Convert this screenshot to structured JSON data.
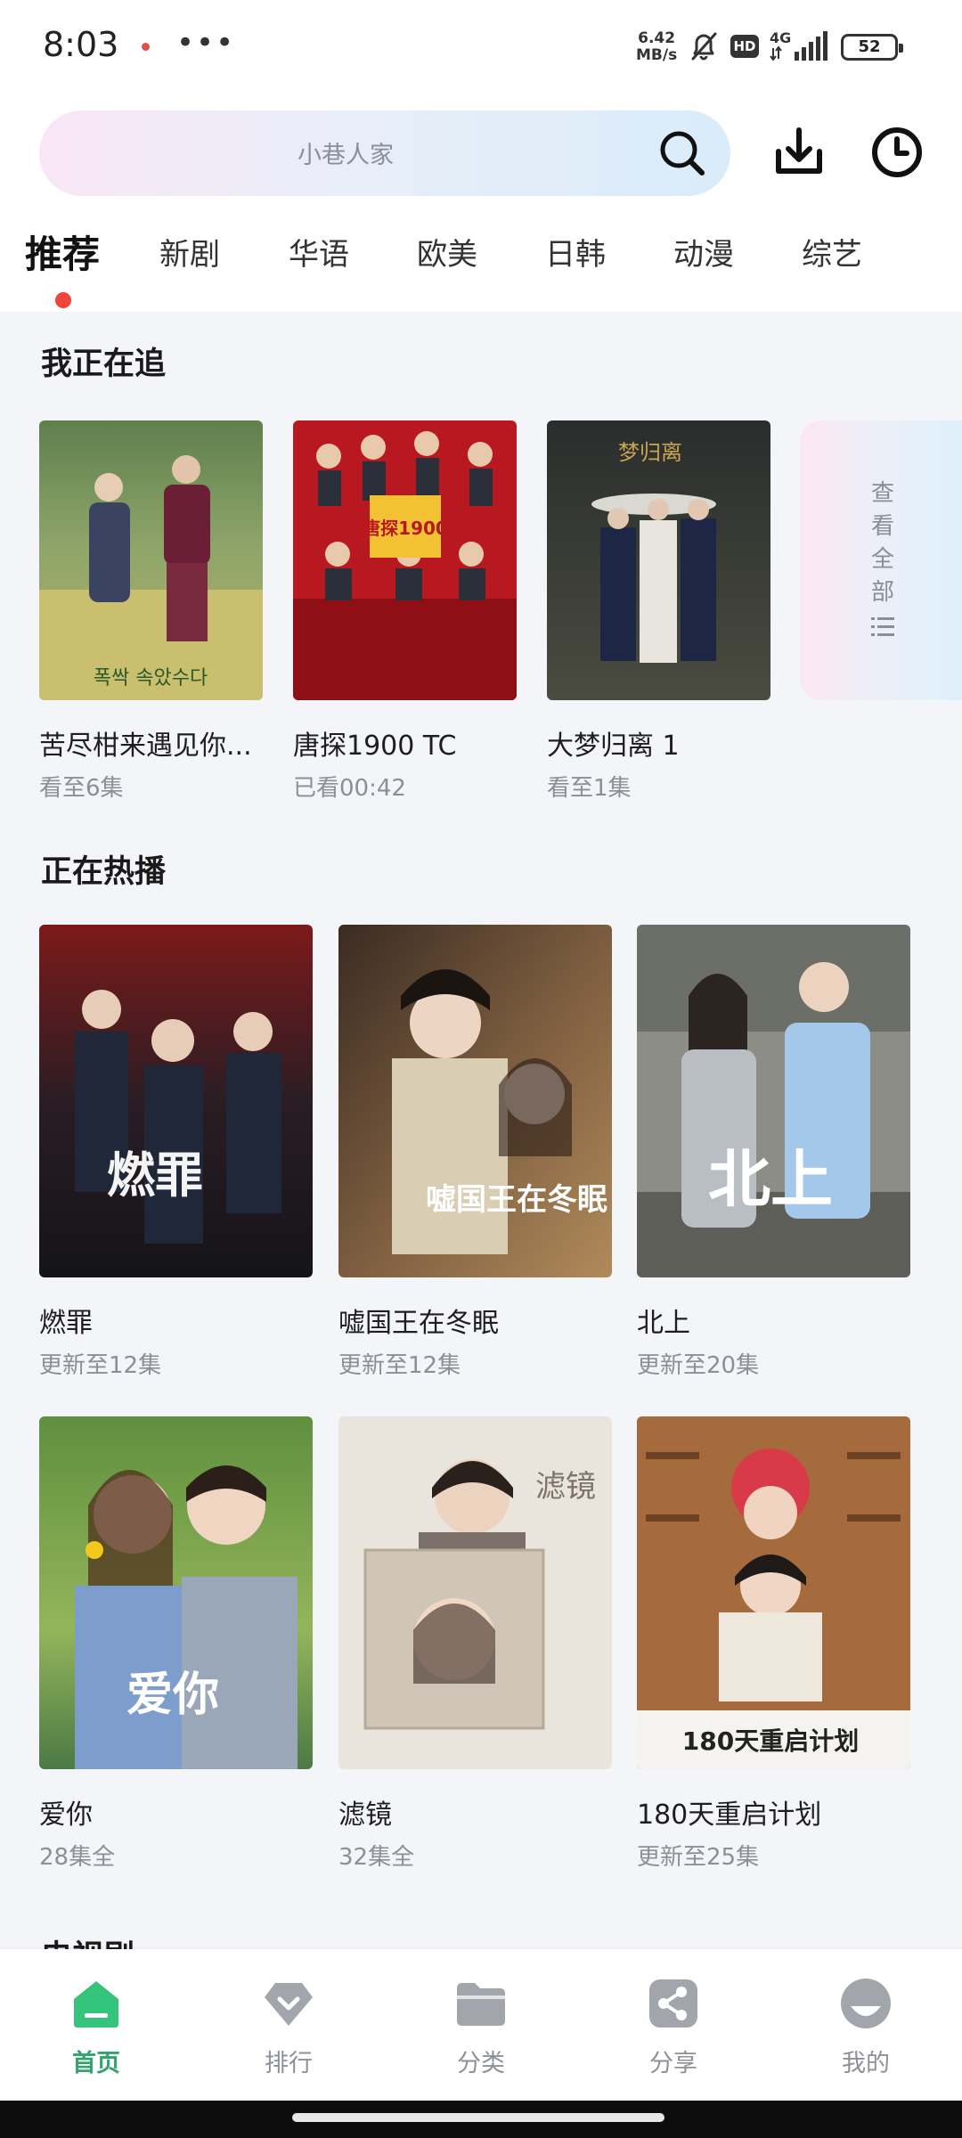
{
  "status": {
    "time": "8:03",
    "dots": "•••",
    "speed_value": "6.42",
    "speed_unit": "MB/s",
    "hd": "HD",
    "network": "4G",
    "battery": "52"
  },
  "search": {
    "placeholder": "小巷人家"
  },
  "tabs": [
    "推荐",
    "新剧",
    "华语",
    "欧美",
    "日韩",
    "动漫",
    "综艺"
  ],
  "following": {
    "title": "我正在追",
    "items": [
      {
        "title": "苦尽柑来遇见你...",
        "progress": "看至6集",
        "poster_text": "폭싹 속았수다"
      },
      {
        "title": "唐探1900 TC",
        "progress": "已看00:42",
        "poster_text": "唐探1900"
      },
      {
        "title": "大梦归离 1",
        "progress": "看至1集",
        "poster_text": "梦归离"
      }
    ],
    "view_all": "查看全部"
  },
  "hot": {
    "title": "正在热播",
    "items": [
      {
        "title": "燃罪",
        "status": "更新至12集",
        "poster_text": "燃罪"
      },
      {
        "title": "嘘国王在冬眠",
        "status": "更新至12集",
        "poster_text": "嘘国王在冬眠"
      },
      {
        "title": "北上",
        "status": "更新至20集",
        "poster_text": "北上"
      },
      {
        "title": "爱你",
        "status": "28集全",
        "poster_text": "爱你"
      },
      {
        "title": "滤镜",
        "status": "32集全",
        "poster_text": "滤镜"
      },
      {
        "title": "180天重启计划",
        "status": "更新至25集",
        "poster_text": "180天重启计划"
      }
    ]
  },
  "next_section": "电视剧",
  "nav": [
    {
      "label": "首页",
      "icon": "home-icon"
    },
    {
      "label": "排行",
      "icon": "ranking-icon"
    },
    {
      "label": "分类",
      "icon": "folder-icon"
    },
    {
      "label": "分享",
      "icon": "share-icon"
    },
    {
      "label": "我的",
      "icon": "profile-icon"
    }
  ],
  "colors": {
    "accent": "#2fa46b",
    "tab_dot": "#f0443c",
    "background": "#f3f5f9"
  }
}
